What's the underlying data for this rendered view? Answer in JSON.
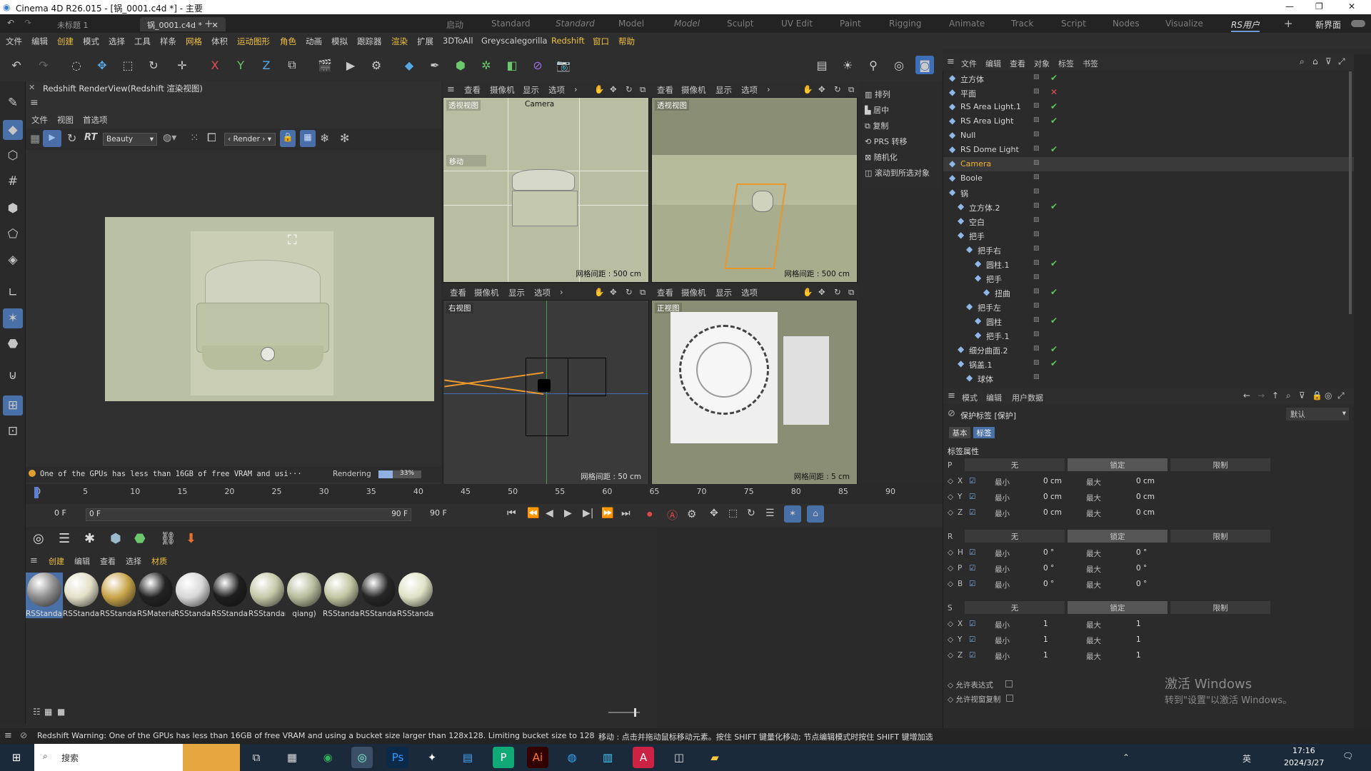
{
  "titlebar": {
    "title": "Cinema 4D R26.015 - [锅_0001.c4d *] - 主要"
  },
  "doc_tabs": [
    "未标题 1",
    "锅_0001.c4d *"
  ],
  "layouts": [
    "启动",
    "Standard",
    "Standard",
    "Model",
    "Model",
    "Sculpt",
    "UV Edit",
    "Paint",
    "Rigging",
    "Animate",
    "Track",
    "Script",
    "Nodes",
    "Visualize",
    "RS用户"
  ],
  "layout_new": "新界面",
  "menubar": [
    "文件",
    "编辑",
    "创建",
    "模式",
    "选择",
    "工具",
    "样条",
    "网格",
    "体积",
    "运动图形",
    "角色",
    "动画",
    "模拟",
    "跟踪器",
    "渲染",
    "扩展",
    "3DToAll",
    "Greyscalegorilla",
    "Redshift",
    "窗口",
    "帮助"
  ],
  "toolbar": {
    "axes": [
      "X",
      "Y",
      "Z"
    ]
  },
  "renderview": {
    "title": "Redshift RenderView(Redshift 渲染视图)",
    "menu": [
      "文件",
      "视图",
      "首选项"
    ],
    "aov": "Beauty",
    "rt": "RT",
    "render_btn": "Render",
    "status": "One of the GPUs has less than 16GB of free VRAM and usi···",
    "rendering_label": "Rendering",
    "rendering_pct": "33%",
    "rendering_fraction": 0.33
  },
  "viewports": [
    {
      "label": "透视视图",
      "camera": "Camera",
      "menu": [
        "查看",
        "摄像机",
        "显示",
        "选项"
      ],
      "grid": "网格间距 : 500 cm",
      "tag": "移动"
    },
    {
      "label": "透视视图",
      "menu": [
        "查看",
        "摄像机",
        "显示",
        "选项"
      ],
      "grid": "网格间距 : 500 cm"
    },
    {
      "label": "右视图",
      "menu": [
        "查看",
        "摄像机",
        "显示",
        "选项"
      ],
      "grid": "网格间距 : 50 cm"
    },
    {
      "label": "正视图",
      "menu": [
        "查看",
        "摄像机",
        "显示",
        "选项"
      ],
      "grid": "网格间距 : 5 cm"
    }
  ],
  "dock": [
    "排列",
    "居中",
    "复制",
    "PRS 转移",
    "随机化",
    "滚动到所选对象"
  ],
  "timeline": {
    "ticks": [
      "0",
      "5",
      "10",
      "15",
      "20",
      "25",
      "30",
      "35",
      "40",
      "45",
      "50",
      "55",
      "60",
      "65",
      "70",
      "75",
      "80",
      "85",
      "90"
    ],
    "current": "0 F",
    "start": "0 F",
    "end": "90 F",
    "end2": "90 F"
  },
  "matmgr": {
    "menu": [
      "创建",
      "编辑",
      "查看",
      "选择",
      "材质"
    ],
    "materials": [
      {
        "name": "RSStandard",
        "color": "#8e8e8e"
      },
      {
        "name": "RSStandard",
        "color": "#e3e0c8"
      },
      {
        "name": "RSStandard",
        "color": "#c9a54a"
      },
      {
        "name": "RSMaterial",
        "color": "#222222"
      },
      {
        "name": "RSStandard",
        "color": "#d8d8d8"
      },
      {
        "name": "RSStandard",
        "color": "#1e1e1e"
      },
      {
        "name": "RSStandard",
        "color": "#c6c9a8"
      },
      {
        "name": "qiang)",
        "color": "#b8bd9d"
      },
      {
        "name": "RSStandard",
        "color": "#c3c7a3"
      },
      {
        "name": "RSStandard",
        "color": "#262626"
      },
      {
        "name": "RSStandard",
        "color": "#dfe2c5"
      }
    ]
  },
  "objmgr": {
    "menu": [
      "文件",
      "编辑",
      "查看",
      "对象",
      "标签",
      "书签"
    ],
    "objects": [
      {
        "name": "立方体",
        "indent": 0,
        "status": "check"
      },
      {
        "name": "平面",
        "indent": 0,
        "status": "x"
      },
      {
        "name": "RS Area Light.1",
        "indent": 0,
        "status": "check"
      },
      {
        "name": "RS Area Light",
        "indent": 0,
        "status": "check"
      },
      {
        "name": "Null",
        "indent": 0,
        "status": ""
      },
      {
        "name": "RS Dome Light",
        "indent": 0,
        "status": "check"
      },
      {
        "name": "Camera",
        "indent": 0,
        "status": "",
        "highlight": true
      },
      {
        "name": "Boole",
        "indent": 0,
        "status": ""
      },
      {
        "name": "锅",
        "indent": 0,
        "status": ""
      },
      {
        "name": "立方体.2",
        "indent": 1,
        "status": "check"
      },
      {
        "name": "空白",
        "indent": 1,
        "status": ""
      },
      {
        "name": "把手",
        "indent": 1,
        "status": ""
      },
      {
        "name": "把手右",
        "indent": 2,
        "status": ""
      },
      {
        "name": "圆柱.1",
        "indent": 3,
        "status": "check"
      },
      {
        "name": "把手",
        "indent": 3,
        "status": ""
      },
      {
        "name": "扭曲",
        "indent": 4,
        "status": "check"
      },
      {
        "name": "把手左",
        "indent": 2,
        "status": ""
      },
      {
        "name": "圆柱",
        "indent": 3,
        "status": "check"
      },
      {
        "name": "把手.1",
        "indent": 3,
        "status": ""
      },
      {
        "name": "细分曲面.2",
        "indent": 1,
        "status": "check"
      },
      {
        "name": "锅盖.1",
        "indent": 1,
        "status": "check"
      },
      {
        "name": "球体",
        "indent": 2,
        "status": ""
      }
    ]
  },
  "attrmgr": {
    "menu": [
      "模式",
      "编辑",
      "用户数据"
    ],
    "title": "保护标签 [保护]",
    "preset": "默认",
    "tabs": [
      "基本",
      "标签"
    ],
    "section": "标签属性",
    "columns": [
      "无",
      "锁定",
      "限制"
    ],
    "groups": [
      {
        "key": "P",
        "rows": [
          {
            "axis": "X",
            "min": "0 cm",
            "max": "0 cm"
          },
          {
            "axis": "Y",
            "min": "0 cm",
            "max": "0 cm"
          },
          {
            "axis": "Z",
            "min": "0 cm",
            "max": "0 cm"
          }
        ]
      },
      {
        "key": "R",
        "rows": [
          {
            "axis": "H",
            "min": "0 °",
            "max": "0 °"
          },
          {
            "axis": "P",
            "min": "0 °",
            "max": "0 °"
          },
          {
            "axis": "B",
            "min": "0 °",
            "max": "0 °"
          }
        ]
      },
      {
        "key": "S",
        "rows": [
          {
            "axis": "X",
            "min": "1",
            "max": "1"
          },
          {
            "axis": "Y",
            "min": "1",
            "max": "1"
          },
          {
            "axis": "Z",
            "min": "1",
            "max": "1"
          }
        ]
      }
    ],
    "min_label": "最小",
    "max_label": "最大",
    "options": [
      "允许表达式",
      "允许视窗复制"
    ]
  },
  "watermark": {
    "line1": "激活 Windows",
    "line2": "转到\"设置\"以激活 Windows。"
  },
  "statusbar": {
    "warning": "Redshift Warning: One of the GPUs has less than 16GB of free VRAM and using a bucket size larger than 128x128. Limiting bucket size to 128",
    "hint": "移动 : 点击并拖动鼠标移动元素。按住 SHIFT 键量化移动; 节点编辑模式时按住 SHIFT 键增加选"
  },
  "taskbar": {
    "search": "搜索",
    "time": "17:16",
    "date": "2024/3/27",
    "ime": "英"
  }
}
